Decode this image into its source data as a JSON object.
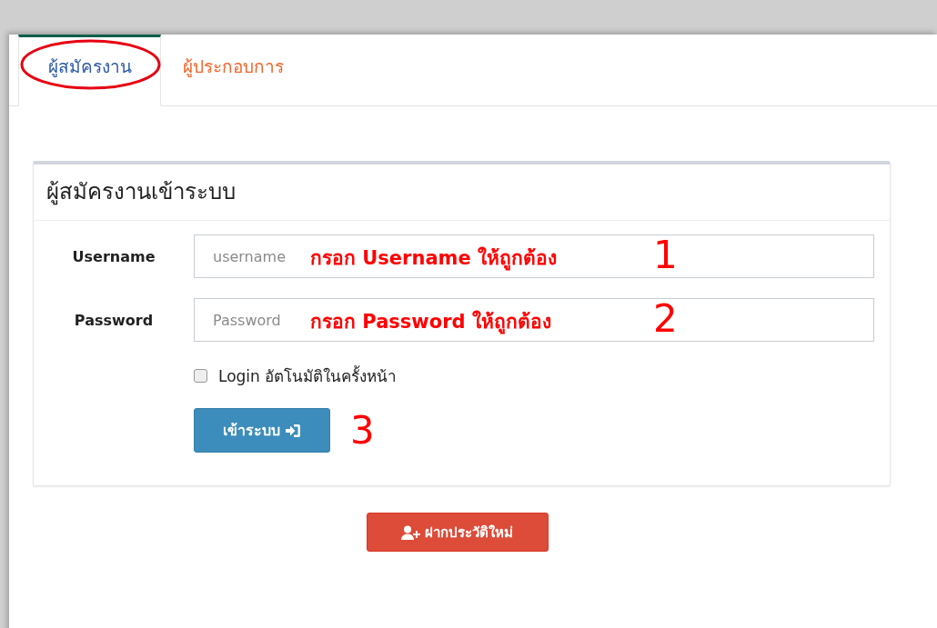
{
  "tabs": [
    {
      "label": "ผู้สมัครงาน",
      "selected": true,
      "circled": true
    },
    {
      "label": "ผู้ประกอบการ",
      "selected": false,
      "circled": false
    }
  ],
  "login_panel": {
    "title": "ผู้สมัครงานเข้าระบบ",
    "fields": [
      {
        "label": "Username",
        "placeholder": "username",
        "annotation": "กรอก Username ให้ถูกต้อง",
        "step": "1"
      },
      {
        "label": "Password",
        "placeholder": "Password",
        "annotation": "กรอก Password ให้ถูกต้อง",
        "step": "2"
      }
    ],
    "remember": {
      "label": "Login อัตโนมัติในครั้งหน้า",
      "checked": false
    },
    "login_button": {
      "label": "เข้าระบบ",
      "step": "3"
    }
  },
  "register_button": {
    "label": "ฝากประวัติใหม่"
  }
}
